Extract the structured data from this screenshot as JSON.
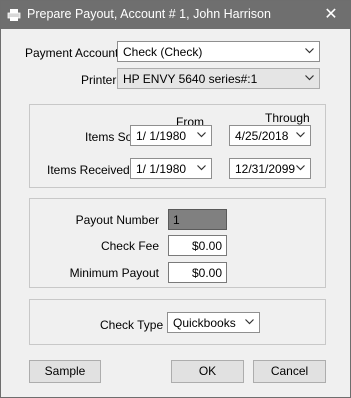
{
  "window": {
    "title": "Prepare Payout, Account # 1, John Harrison",
    "close_glyph": "✕"
  },
  "payment": {
    "account_label": "Payment Account:",
    "account_value": "Check (Check)",
    "printer_label": "Printer",
    "printer_value": "HP ENVY 5640 series#:1"
  },
  "dates": {
    "from_header": "From",
    "through_header": "Through",
    "items_sold_label": "Items Sold",
    "items_sold_from": "1/  1/1980",
    "items_sold_through": "4/25/2018",
    "items_received_label": "Items Received",
    "items_received_from": "1/  1/1980",
    "items_received_through": "12/31/2099"
  },
  "payout": {
    "payout_number_label": "Payout Number",
    "payout_number_value": "1",
    "check_fee_label": "Check Fee",
    "check_fee_value": "$0.00",
    "minimum_payout_label": "Minimum Payout",
    "minimum_payout_value": "$0.00"
  },
  "check": {
    "check_type_label": "Check Type",
    "check_type_value": "Quickbooks"
  },
  "buttons": {
    "sample": "Sample",
    "ok": "OK",
    "cancel": "Cancel"
  }
}
